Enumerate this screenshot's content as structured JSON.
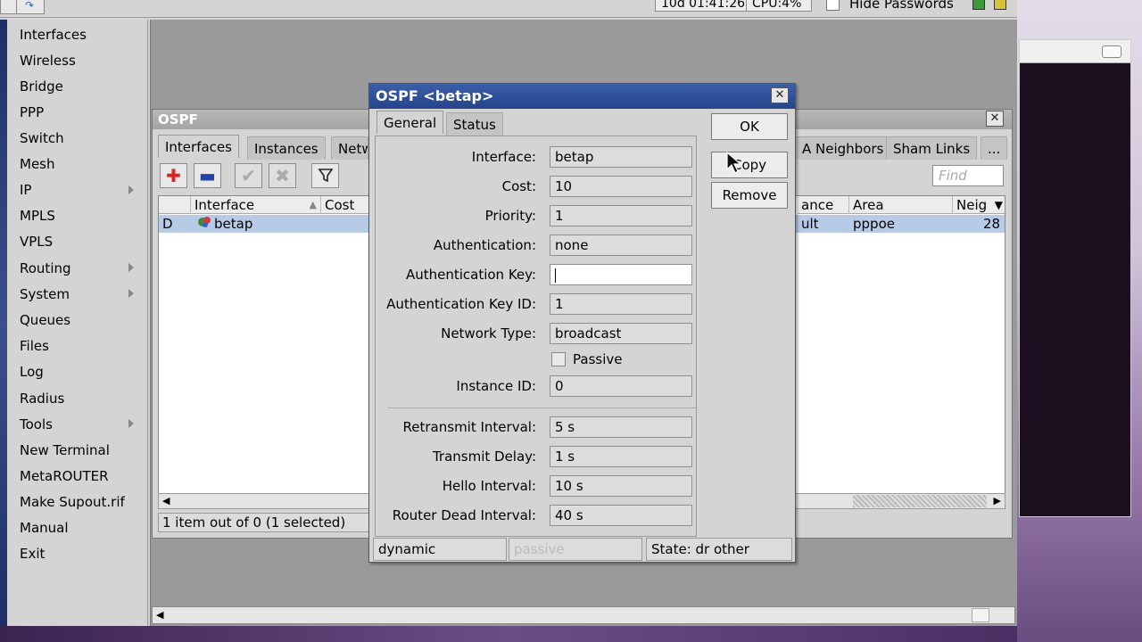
{
  "topbar": {
    "uptime": "10d 01:41:26",
    "cpu": "CPU:4%",
    "hide_passwords_label": "Hide Passwords",
    "hide_passwords_checked": false
  },
  "sidebar": {
    "items": [
      {
        "label": "Interfaces",
        "submenu": false
      },
      {
        "label": "Wireless",
        "submenu": false
      },
      {
        "label": "Bridge",
        "submenu": false
      },
      {
        "label": "PPP",
        "submenu": false
      },
      {
        "label": "Switch",
        "submenu": false
      },
      {
        "label": "Mesh",
        "submenu": false
      },
      {
        "label": "IP",
        "submenu": true
      },
      {
        "label": "MPLS",
        "submenu": false
      },
      {
        "label": "VPLS",
        "submenu": false
      },
      {
        "label": "Routing",
        "submenu": true
      },
      {
        "label": "System",
        "submenu": true
      },
      {
        "label": "Queues",
        "submenu": false
      },
      {
        "label": "Files",
        "submenu": false
      },
      {
        "label": "Log",
        "submenu": false
      },
      {
        "label": "Radius",
        "submenu": false
      },
      {
        "label": "Tools",
        "submenu": true
      },
      {
        "label": "New Terminal",
        "submenu": false
      },
      {
        "label": "MetaROUTER",
        "submenu": false
      },
      {
        "label": "Make Supout.rif",
        "submenu": false
      },
      {
        "label": "Manual",
        "submenu": false
      },
      {
        "label": "Exit",
        "submenu": false
      }
    ]
  },
  "ospf_window": {
    "title": "OSPF",
    "tabs": [
      "Interfaces",
      "Instances",
      "Netw",
      "A Neighbors",
      "Sham Links",
      "..."
    ],
    "find_placeholder": "Find",
    "columns": [
      "Interface",
      "Cost",
      "ance",
      "Area",
      "Neig"
    ],
    "rows": [
      {
        "flag": "D",
        "interface": "betap",
        "instance": "ult",
        "area": "pppoe",
        "neighbors": "28"
      }
    ],
    "status": "1 item out of 0 (1 selected)"
  },
  "dialog": {
    "title": "OSPF <betap>",
    "tabs": [
      "General",
      "Status"
    ],
    "buttons": {
      "ok": "OK",
      "copy": "Copy",
      "remove": "Remove"
    },
    "fields": {
      "interface": {
        "label": "Interface:",
        "value": "betap"
      },
      "cost": {
        "label": "Cost:",
        "value": "10"
      },
      "priority": {
        "label": "Priority:",
        "value": "1"
      },
      "authentication": {
        "label": "Authentication:",
        "value": "none"
      },
      "auth_key": {
        "label": "Authentication Key:",
        "value": ""
      },
      "auth_key_id": {
        "label": "Authentication Key ID:",
        "value": "1"
      },
      "network_type": {
        "label": "Network Type:",
        "value": "broadcast"
      },
      "passive": {
        "label": "Passive",
        "checked": false
      },
      "instance_id": {
        "label": "Instance ID:",
        "value": "0"
      },
      "retransmit_interval": {
        "label": "Retransmit Interval:",
        "value": "5 s"
      },
      "transmit_delay": {
        "label": "Transmit Delay:",
        "value": "1 s"
      },
      "hello_interval": {
        "label": "Hello Interval:",
        "value": "10 s"
      },
      "router_dead_interval": {
        "label": "Router Dead Interval:",
        "value": "40 s"
      }
    },
    "status_bar": {
      "dynamic": "dynamic",
      "passive": "passive",
      "state": "State: dr other"
    }
  }
}
